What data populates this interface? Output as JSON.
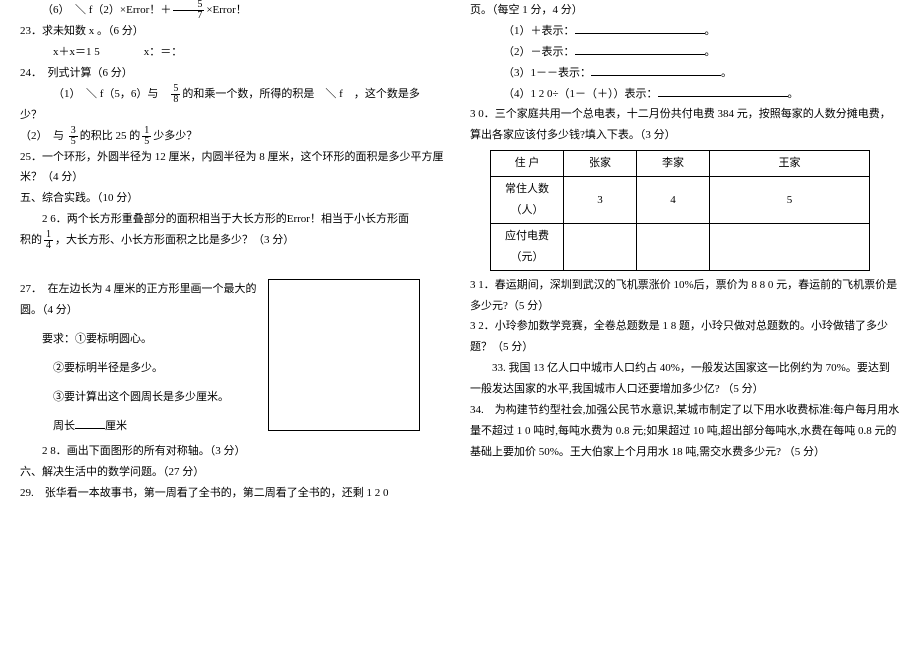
{
  "left": {
    "q22_6": "（6）　＼ f（2）×Error！＋",
    "q22_6b": "×Error！",
    "q23": "23．求未知数 x 。（6 分）",
    "q23_line": "x＋x＝1 5　　　　x：＝：",
    "q24": "24．　列式计算（6 分）",
    "q24_1a": "（1）　＼ f（5，6）与　",
    "q24_1b": "的和乘一个数，所得的积是　＼ f　，这个数是多",
    "q24_1c": "少？",
    "q24_2a": "（2）　与",
    "q24_2b": "的积比 25 的",
    "q24_2c": "少多少？",
    "q25": "25．一个环形，外圆半径为 12 厘米，内圆半径为 8 厘米，这个环形的面积是多少平方厘米？（4 分）",
    "sec5": "五、综合实践。（10 分）",
    "q26a": "2 6．两个长方形重叠部分的面积相当于大长方形的Error！相当于小长方形面",
    "q26b": "积的",
    "q26c": "，大长方形、小长方形面积之比是多少？（3 分）",
    "q27": "27．　在左边长为 4 厘米的正方形里画一个最大的圆。（4 分）",
    "q27_r1": "要求：①要标明圆心。",
    "q27_r2": "②要标明半径是多少。",
    "q27_r3": "③要计算出这个圆周长是多少厘米。",
    "q27_r4a": "周长",
    "q27_r4b": "厘米",
    "q28": "2 8．画出下面图形的所有对称轴。（3 分）",
    "sec6": "六、解决生活中的数学问题。（27 分）",
    "q29": "29.　张华看一本故事书，第一周看了全书的，第二周看了全书的，还剩 1 2 0"
  },
  "right": {
    "q29b": "页。（每空 1 分，4 分）",
    "q29_1": "（1）＋表示：",
    "q29_2": "（2）－表示：",
    "q29_3": "（3）1－－表示：",
    "q29_4": "（4）1 2 0÷（1－（＋））表示：",
    "q30": "3 0．三个家庭共用一个总电表，十二月份共付电费 384 元，按照每家的人数分摊电费，算出各家应该付多少钱?填入下表。（3 分）",
    "q31": "3 1．春运期间，深圳到武汉的飞机票涨价 10%后，票价为 8 8 0 元，春运前的飞机票价是多少元?（5 分）",
    "q32": "3 2．小玲参加数学竞赛，全卷总题数是 1 8 题，小玲只做对总题数的。小玲做错了多少题？（5 分）",
    "q33": "33. 我国 13 亿人口中城市人口约占 40%，一般发达国家这一比例约为 70%。要达到一般发达国家的水平,我国城市人口还要增加多少亿? （5 分）",
    "q34": "34.　为构建节约型社会,加强公民节水意识,某城市制定了以下用水收费标准:每户每月用水量不超过 1 0 吨时,每吨水费为 0.8 元;如果超过 10 吨,超出部分每吨水,水费在每吨 0.8 元的基础上要加价 50%。王大伯家上个月用水 18 吨,需交水费多少元? （5 分）"
  },
  "table": {
    "h0": "住\n户",
    "h1": "张家",
    "h2": "李家",
    "h3": "王家",
    "r1": "常住人数\n（人）",
    "r1a": "3",
    "r1b": "4",
    "r1c": "5",
    "r2": "应付电费\n（元）"
  }
}
